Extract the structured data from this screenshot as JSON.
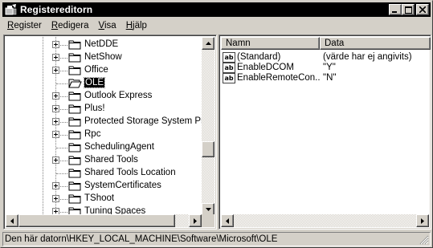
{
  "window": {
    "title": "Registereditorn"
  },
  "menu": [
    {
      "accel": "R",
      "rest": "egister"
    },
    {
      "accel": "R",
      "rest": "edigera"
    },
    {
      "accel": "V",
      "rest": "isa"
    },
    {
      "accel": "H",
      "rest": "jälp"
    }
  ],
  "tree": {
    "items": [
      {
        "label": "NetDDE",
        "expander": "+"
      },
      {
        "label": "NetShow",
        "expander": "+"
      },
      {
        "label": "Office",
        "expander": "+"
      },
      {
        "label": "OLE",
        "expander": "",
        "selected": true
      },
      {
        "label": "Outlook Express",
        "expander": "+"
      },
      {
        "label": "Plus!",
        "expander": "+"
      },
      {
        "label": "Protected Storage System Pr",
        "expander": "+"
      },
      {
        "label": "Rpc",
        "expander": "+"
      },
      {
        "label": "SchedulingAgent",
        "expander": ""
      },
      {
        "label": "Shared Tools",
        "expander": "+"
      },
      {
        "label": "Shared Tools Location",
        "expander": ""
      },
      {
        "label": "SystemCertificates",
        "expander": "+"
      },
      {
        "label": "TShoot",
        "expander": "+"
      },
      {
        "label": "Tuning Spaces",
        "expander": "+"
      }
    ]
  },
  "list": {
    "columns": [
      "Namn",
      "Data"
    ],
    "rows": [
      {
        "name": "(Standard)",
        "data": "(värde har ej angivits)",
        "icon": "ab"
      },
      {
        "name": "EnableDCOM",
        "data": "\"Y\"",
        "icon": "ab"
      },
      {
        "name": "EnableRemoteCon...",
        "data": "\"N\"",
        "icon": "ab"
      }
    ]
  },
  "status": {
    "text": "Den här datorn\\HKEY_LOCAL_MACHINE\\Software\\Microsoft\\OLE"
  },
  "icons": {
    "app": "registry-editor-icon",
    "folder": "folder-icon",
    "folder_open": "open-folder-icon",
    "string_value": "string-value-icon"
  }
}
